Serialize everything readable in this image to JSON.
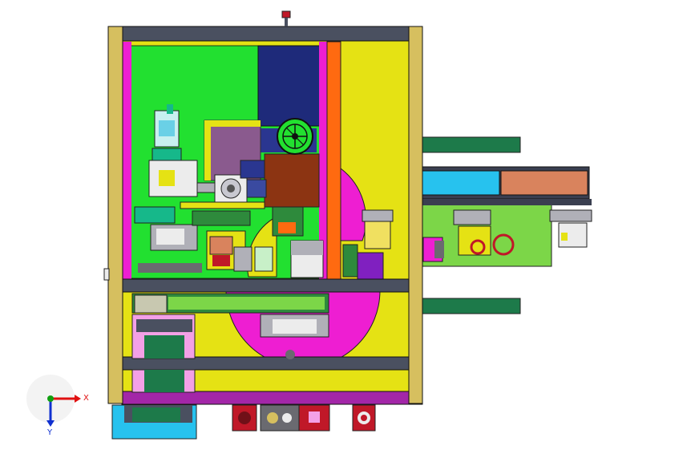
{
  "viewport": {
    "background": "#ffffff"
  },
  "triad": {
    "x_label": "X",
    "y_label": "Y",
    "x_color": "#e01010",
    "y_color": "#10a010",
    "z_color": "#1030d0"
  },
  "colors": {
    "frame_gray": "#4a5060",
    "frame_post": "#d6bf5f",
    "plate_yellow": "#e5e214",
    "plate_green": "#22e030",
    "magenta": "#ee1ed2",
    "purple": "#a326a8",
    "orange": "#ff6a10",
    "navy": "#1e2a7a",
    "brown": "#8c3412",
    "cyan": "#27c2ee",
    "teal": "#16b88a",
    "salmon": "#d9835d",
    "dark_green": "#1d7a4a",
    "light_green": "#7cd648",
    "olive_green": "#2e8a3c",
    "mauve": "#8a5a8e",
    "pink": "#f3a0e6",
    "red": "#c01828",
    "gray_light": "#b0b0b8",
    "white_part": "#ececec"
  }
}
